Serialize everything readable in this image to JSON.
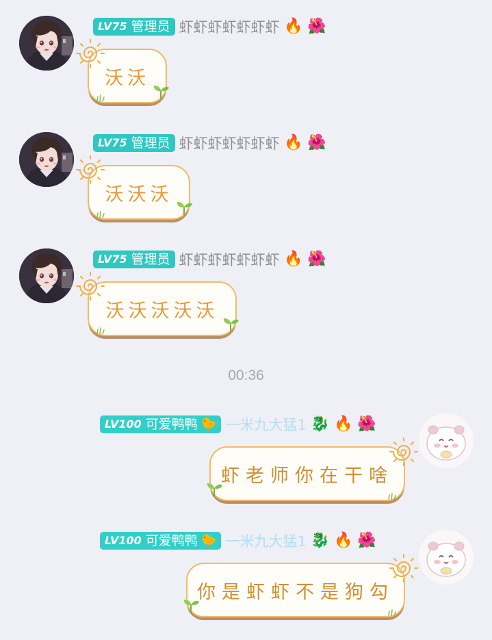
{
  "messages_top": [
    {
      "level": "LV75",
      "title": "管理员",
      "sender": "虾虾虾虾虾虾虾",
      "badges": [
        "fire-icon",
        "flower-face-icon"
      ],
      "text": "沃沃"
    },
    {
      "level": "LV75",
      "title": "管理员",
      "sender": "虾虾虾虾虾虾虾",
      "badges": [
        "fire-icon",
        "flower-face-icon"
      ],
      "text": "沃沃沃"
    },
    {
      "level": "LV75",
      "title": "管理员",
      "sender": "虾虾虾虾虾虾虾",
      "badges": [
        "fire-icon",
        "flower-face-icon"
      ],
      "text": "沃沃沃沃沃"
    }
  ],
  "timestamp": "00:36",
  "messages_bottom": [
    {
      "level": "LV100",
      "title": "可爱鸭鸭",
      "sender": "一米九大猛1",
      "badges": [
        "dragon-icon",
        "fire-icon",
        "flower-face-icon"
      ],
      "text": "虾老师你在干啥"
    },
    {
      "level": "LV100",
      "title": "可爱鸭鸭",
      "sender": "一米九大猛1",
      "badges": [
        "dragon-icon",
        "fire-icon",
        "flower-face-icon"
      ],
      "text": "你是虾虾不是狗勾"
    }
  ],
  "colors": {
    "background": "#eef0f6",
    "level_tag": "#2fc7c2",
    "bubble_border": "#f2ba66",
    "bubble_text": "#e59a3a",
    "right_sender": "#b3def4"
  }
}
